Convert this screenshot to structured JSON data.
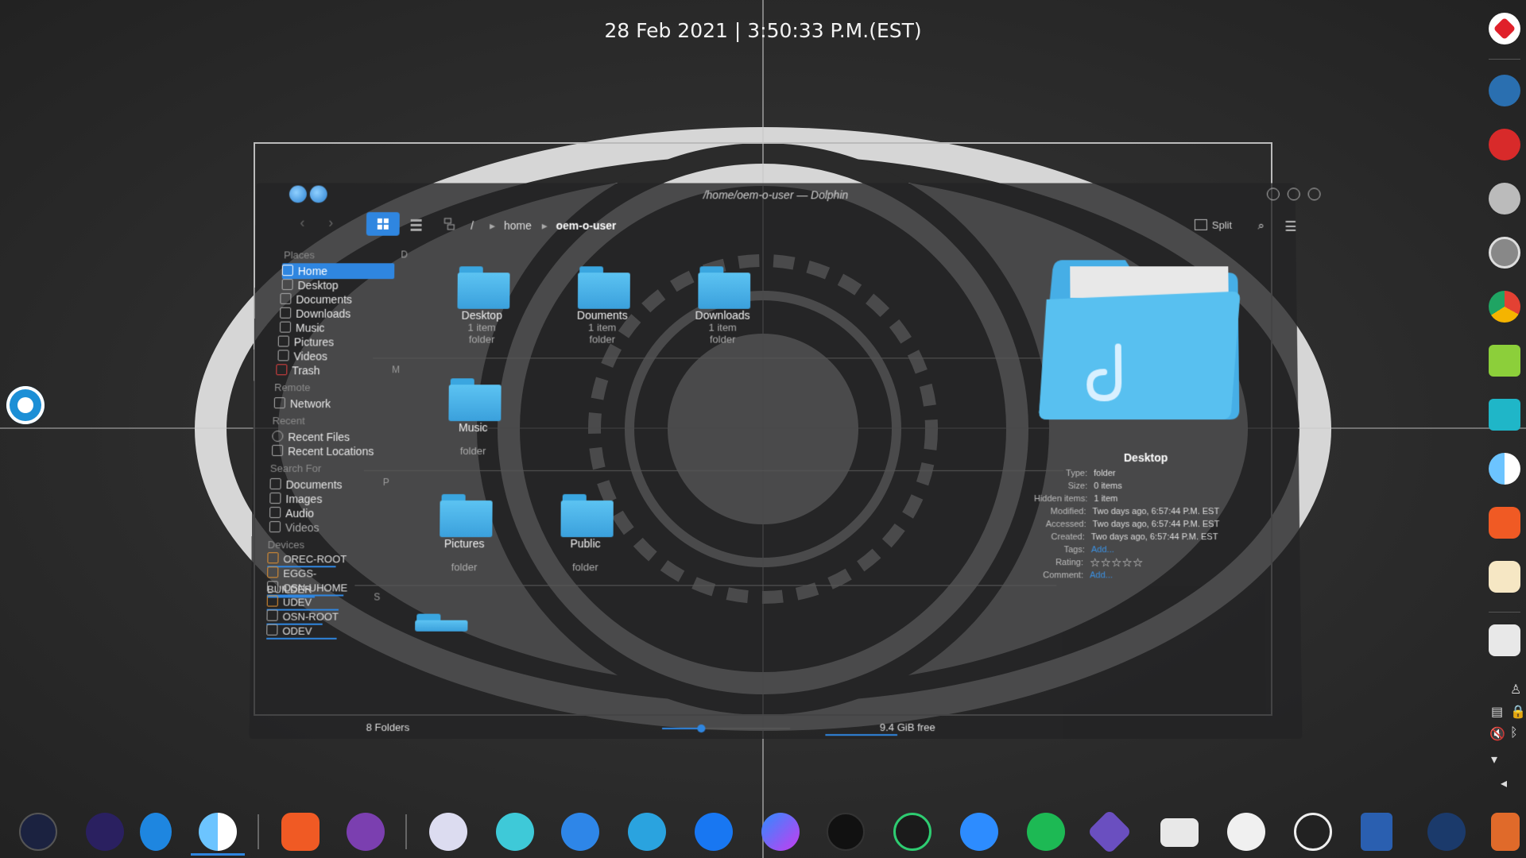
{
  "clock": {
    "text": "28 Feb 2021 | 3:50:33 P.M.(EST)"
  },
  "window": {
    "title": "/home/oem-o-user — Dolphin",
    "breadcrumb": [
      "/",
      "home",
      "oem-o-user"
    ],
    "split_label": "Split",
    "sidebar": {
      "places_label": "Places",
      "places": [
        "Home",
        "Desktop",
        "Documents",
        "Downloads",
        "Music",
        "Pictures",
        "Videos",
        "Trash"
      ],
      "remote_label": "Remote",
      "remote": [
        "Network"
      ],
      "recent_label": "Recent",
      "recent": [
        "Recent Files",
        "Recent Locations"
      ],
      "search_label": "Search For",
      "search": [
        "Documents",
        "Images",
        "Audio",
        "Videos"
      ],
      "devices_label": "Devices",
      "devices": [
        "OREC-ROOT",
        "EGGS-BUILDER",
        "OSN-UHOME",
        "UDEV",
        "OSN-ROOT",
        "ODEV"
      ]
    },
    "groups": {
      "d": "D",
      "m": "M",
      "p": "P",
      "s": "S"
    },
    "files": [
      {
        "name": "Desktop",
        "sub1": "1 item",
        "sub2": "folder"
      },
      {
        "name": "Douments",
        "sub1": "1 item",
        "sub2": "folder"
      },
      {
        "name": "Downloads",
        "sub1": "1 item",
        "sub2": "folder"
      },
      {
        "name": "Music",
        "sub1": "",
        "sub2": "folder"
      },
      {
        "name": "Pictures",
        "sub1": "",
        "sub2": "folder"
      },
      {
        "name": "Public",
        "sub1": "",
        "sub2": "folder"
      }
    ],
    "info": {
      "title": "Desktop",
      "rows": [
        {
          "k": "Type:",
          "v": "folder"
        },
        {
          "k": "Size:",
          "v": "0 items"
        },
        {
          "k": "Hidden items:",
          "v": "1 item"
        },
        {
          "k": "Modified:",
          "v": "Two days ago, 6:57:44 P.M. EST"
        },
        {
          "k": "Accessed:",
          "v": "Two days ago, 6:57:44 P.M. EST"
        },
        {
          "k": "Created:",
          "v": "Two days ago, 6:57:44 P.M. EST"
        },
        {
          "k": "Tags:",
          "v": "Add..."
        },
        {
          "k": "Rating:",
          "v": "☆☆☆☆☆"
        },
        {
          "k": "Comment:",
          "v": "Add..."
        }
      ]
    },
    "status": {
      "folders": "8 Folders",
      "free": "9.4 GiB free",
      "zoom_fraction": 0.3
    }
  },
  "right_dock": [
    "record-icon",
    "linux-icon",
    "font-app-icon",
    "settings-gear-icon",
    "disks-icon",
    "chrome-icon",
    "cube-green-icon",
    "cube-cyan-icon",
    "finder-icon",
    "brave-icon",
    "notes-icon",
    "trash-icon"
  ],
  "bottom_dock": [
    "launcher-icon",
    "more-icon",
    "safari-icon",
    "finder-icon",
    "brave-icon",
    "eagle-icon",
    "archive-icon",
    "mail-icon",
    "messages-icon",
    "telegram-icon",
    "facebook-icon",
    "messenger-icon",
    "tiktok-icon",
    "whatsapp-icon",
    "zoom-icon",
    "spotify-icon",
    "kdenlive-icon",
    "stack-icon",
    "play-icon",
    "obs-icon",
    "kdeconnect-icon",
    "steam-icon",
    "weather-icon"
  ],
  "colors": {
    "accent": "#2f86e0",
    "folder": "#4fb6ea"
  }
}
